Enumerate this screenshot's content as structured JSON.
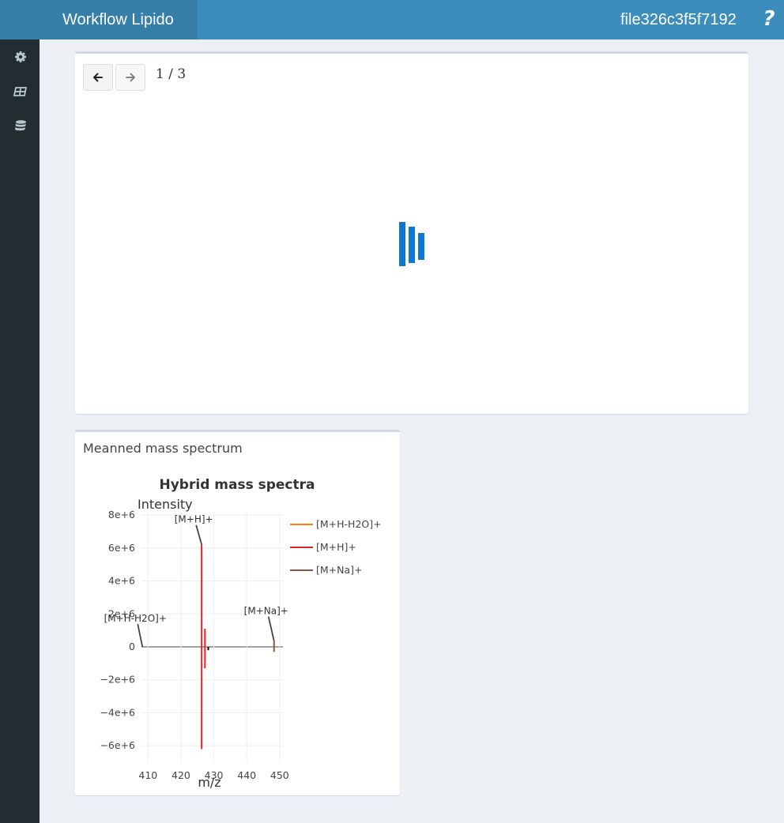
{
  "header": {
    "app_title": "Workflow Lipido",
    "file_name": "file326c3f5f7192",
    "help_symbol": "?"
  },
  "sidebar": {
    "items": [
      {
        "icon": "gear-icon"
      },
      {
        "icon": "table-icon"
      },
      {
        "icon": "database-icon"
      }
    ]
  },
  "viewer": {
    "page_indicator": "1 / 3"
  },
  "spectrum_box": {
    "title": "Meanned mass spectrum"
  },
  "colors": {
    "header": "#3c8dbc",
    "logo": "#367fa9",
    "sidebar": "#222d32",
    "spinner": "#0f77d1"
  },
  "chart_data": {
    "type": "line",
    "title": "Hybrid mass spectra",
    "ylabel": "Intensity",
    "xlabel": "m/z",
    "xlim": [
      408,
      451
    ],
    "ylim": [
      -7000000,
      8200000
    ],
    "xticks": [
      {
        "v": 410,
        "label": "410"
      },
      {
        "v": 420,
        "label": "420"
      },
      {
        "v": 430,
        "label": "430"
      },
      {
        "v": 440,
        "label": "440"
      },
      {
        "v": 450,
        "label": "450"
      }
    ],
    "yticks": [
      {
        "v": 8000000,
        "label": "8e+6"
      },
      {
        "v": 6000000,
        "label": "6e+6"
      },
      {
        "v": 4000000,
        "label": "4e+6"
      },
      {
        "v": 2000000,
        "label": "2e+6"
      },
      {
        "v": 0,
        "label": "0"
      },
      {
        "v": -2000000,
        "label": "−2e+6"
      },
      {
        "v": -4000000,
        "label": "−4e+6"
      },
      {
        "v": -6000000,
        "label": "−6e+6"
      }
    ],
    "grid": true,
    "legend_position": "right",
    "series": [
      {
        "name": "[M+H-H2O]+",
        "color": "#ff7f0e",
        "peaks": [
          {
            "x": 408.3,
            "y": 50000
          }
        ]
      },
      {
        "name": "[M+H]+",
        "color": "#d62728",
        "peaks": [
          {
            "x": 426.3,
            "y": 6200000
          },
          {
            "x": 426.3,
            "y": -6200000
          },
          {
            "x": 427.3,
            "y": 1100000
          },
          {
            "x": 427.3,
            "y": -1300000
          }
        ]
      },
      {
        "name": "[M+Na]+",
        "color": "#8c564b",
        "peaks": [
          {
            "x": 448.3,
            "y": 350000
          },
          {
            "x": 448.3,
            "y": -300000
          }
        ]
      }
    ],
    "other_peaks": [
      {
        "x": 428.3,
        "y": -200000,
        "color": "#000000"
      }
    ],
    "annotations": [
      {
        "text": "[M+H]+",
        "x": 426.3,
        "y": 6200000,
        "dx": -10,
        "dy": -28
      },
      {
        "text": "[M+H-H2O]+",
        "x": 408.3,
        "y": 0,
        "dx": -9,
        "dy": -32
      },
      {
        "text": "[M+Na]+",
        "x": 448.3,
        "y": 350000,
        "dx": -10,
        "dy": -34
      }
    ]
  }
}
